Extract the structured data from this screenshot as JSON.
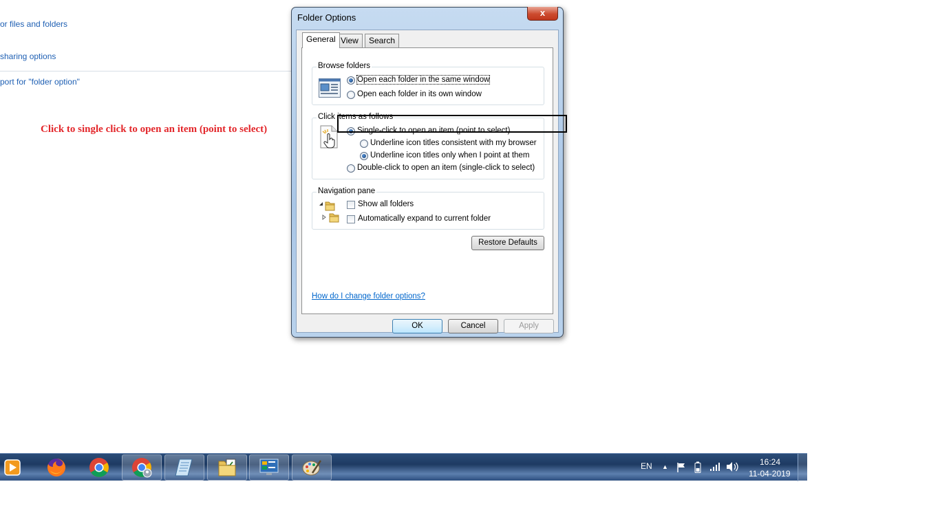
{
  "background": {
    "links": [
      "or files and folders",
      "sharing options",
      "port for \"folder option\""
    ],
    "annotation": "Click to single click to open an item (point to select)"
  },
  "dialog": {
    "title": "Folder Options",
    "close_label": "x",
    "tabs": [
      "General",
      "View",
      "Search"
    ],
    "browse_folders": {
      "label": "Browse folders",
      "options": [
        "Open each folder in the same window",
        "Open each folder in its own window"
      ],
      "selected": 0
    },
    "click_items": {
      "label": "Click items as follows",
      "single_click": "Single-click to open an item (point to select)",
      "underline_browser": "Underline icon titles consistent with my browser",
      "underline_point": "Underline icon titles only when I point at them",
      "double_click": "Double-click to open an item (single-click to select)"
    },
    "navigation_pane": {
      "label": "Navigation pane",
      "show_all": "Show all folders",
      "auto_expand": "Automatically expand to current folder"
    },
    "restore_label": "Restore Defaults",
    "help_link": "How do I change folder options?",
    "ok_label": "OK",
    "cancel_label": "Cancel",
    "apply_label": "Apply"
  },
  "taskbar": {
    "apps": [
      "media-player",
      "firefox",
      "chrome",
      "chrome-profile",
      "notepad",
      "file-explorer",
      "control-panel",
      "paint"
    ],
    "language": "EN",
    "time": "16:24",
    "date": "11-04-2019"
  }
}
